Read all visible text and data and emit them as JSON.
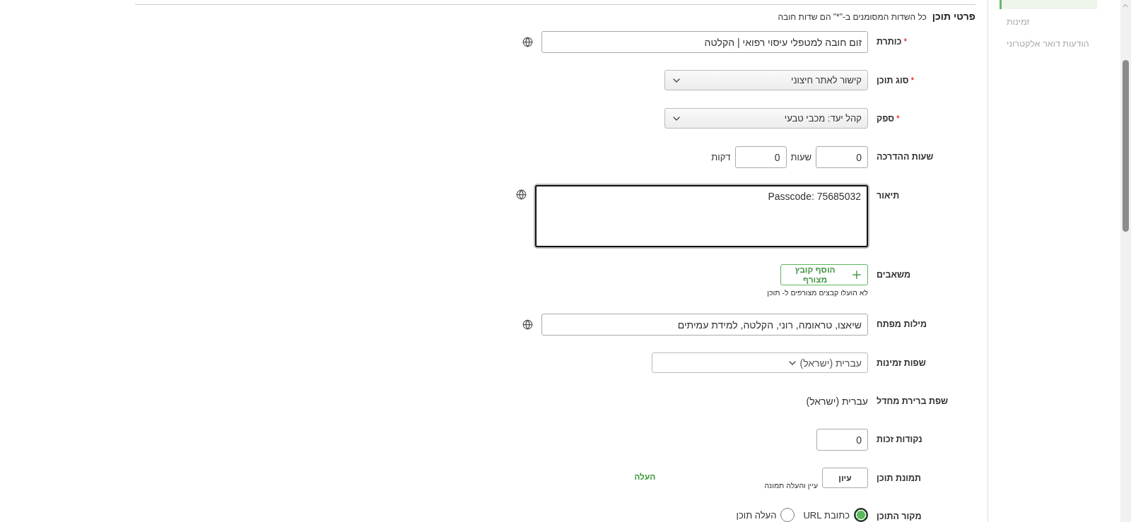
{
  "section": {
    "title": "פרטי תוכן",
    "note": "כל השדות המסומנים ב-\"*\" הם שדות חובה"
  },
  "fields": [
    {
      "kind": "text",
      "label": "כותרת",
      "required_mark": "*",
      "value": "זום חובה למטפלי עיסוי רפואי | הקלטה",
      "translatable": true
    },
    {
      "kind": "select",
      "label": "סוג תוכן",
      "required_mark": "*",
      "value": "קישור לאתר חיצוני"
    },
    {
      "kind": "select",
      "label": "ספק",
      "required_mark": "*",
      "value": "קהל יעד: מכבי טבעי"
    },
    {
      "kind": "duration",
      "label": "שעות ההדרכה",
      "hours": "0",
      "hours_unit": "שעות",
      "minutes": "0",
      "minutes_unit": "דקות"
    },
    {
      "kind": "textarea",
      "label": "תיאור",
      "value": "Passcode: 75685032",
      "translatable": true
    },
    {
      "kind": "attachments",
      "label": "משאבים",
      "button": "הוסף קובץ מצורף",
      "note": "לא הועלו קבצים מצורפים ל- תוכן"
    },
    {
      "kind": "text",
      "label": "מילות מפתח",
      "value": "שיאצו, טראומה, רוני, הקלטה, למידת עמיתים",
      "translatable": true
    },
    {
      "kind": "multiselect",
      "label": "שפות זמינות",
      "value": "עברית (ישראל)"
    },
    {
      "kind": "static",
      "label": "שפת ברירת מחדל",
      "value": "עברית (ישראל)"
    },
    {
      "kind": "number",
      "label": "נקודות זכות",
      "value": "0"
    },
    {
      "kind": "image",
      "label": "תמונת תוכן",
      "button": "עיון",
      "hint": "עיין והעלה תמונה",
      "link": "העלה"
    },
    {
      "kind": "radio",
      "label": "מקור התוכן",
      "options": [
        {
          "label": "כתובת URL",
          "selected": true
        },
        {
          "label": "העלה תוכן",
          "selected": false
        }
      ]
    }
  ],
  "sidebar": {
    "items": [
      {
        "label": "זמינות",
        "selected": false
      },
      {
        "label": "הודעות דואר אלקטרוני",
        "selected": false
      }
    ]
  }
}
